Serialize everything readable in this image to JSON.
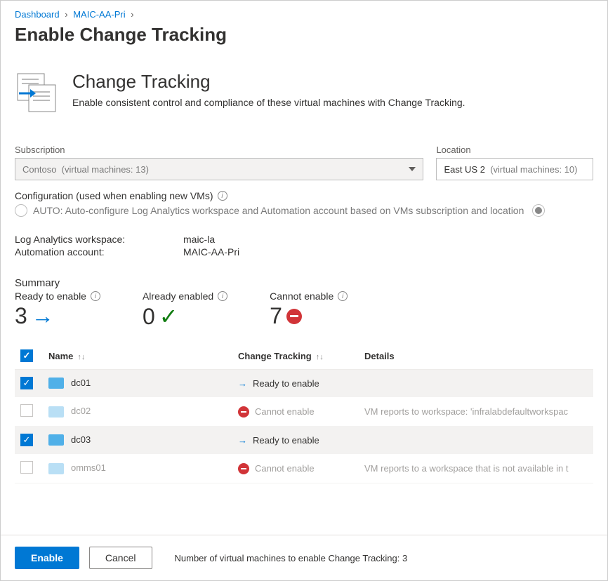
{
  "breadcrumb": {
    "items": [
      "Dashboard",
      "MAIC-AA-Pri"
    ]
  },
  "page_title": "Enable Change Tracking",
  "hero": {
    "title": "Change Tracking",
    "subtitle": "Enable consistent control and compliance of these virtual machines with Change Tracking."
  },
  "filters": {
    "subscription": {
      "label": "Subscription",
      "value": "Contoso",
      "suffix": "(virtual machines: 13)"
    },
    "location": {
      "label": "Location",
      "value": "East US 2",
      "suffix": "(virtual machines: 10)"
    }
  },
  "config": {
    "label": "Configuration (used when enabling new VMs)",
    "option": "AUTO: Auto-configure Log Analytics workspace and Automation account based on VMs subscription and location"
  },
  "workspace": {
    "law_label": "Log Analytics workspace:",
    "law_value": "maic-la",
    "aa_label": "Automation account:",
    "aa_value": "MAIC-AA-Pri"
  },
  "summary": {
    "title": "Summary",
    "ready": {
      "label": "Ready to enable",
      "value": "3"
    },
    "already": {
      "label": "Already enabled",
      "value": "0"
    },
    "cannot": {
      "label": "Cannot enable",
      "value": "7"
    }
  },
  "table": {
    "headers": {
      "name": "Name",
      "tracking": "Change Tracking",
      "details": "Details"
    },
    "rows": [
      {
        "checked": true,
        "name": "dc01",
        "status": "ready",
        "status_text": "Ready to enable",
        "details": ""
      },
      {
        "checked": false,
        "name": "dc02",
        "status": "cannot",
        "status_text": "Cannot enable",
        "details": "VM reports to workspace: 'infralabdefaultworkspac"
      },
      {
        "checked": true,
        "name": "dc03",
        "status": "ready",
        "status_text": "Ready to enable",
        "details": ""
      },
      {
        "checked": false,
        "name": "omms01",
        "status": "cannot",
        "status_text": "Cannot enable",
        "details": "VM reports to a workspace that is not available in t"
      }
    ]
  },
  "footer": {
    "enable": "Enable",
    "cancel": "Cancel",
    "text": "Number of virtual machines to enable Change Tracking: 3"
  }
}
